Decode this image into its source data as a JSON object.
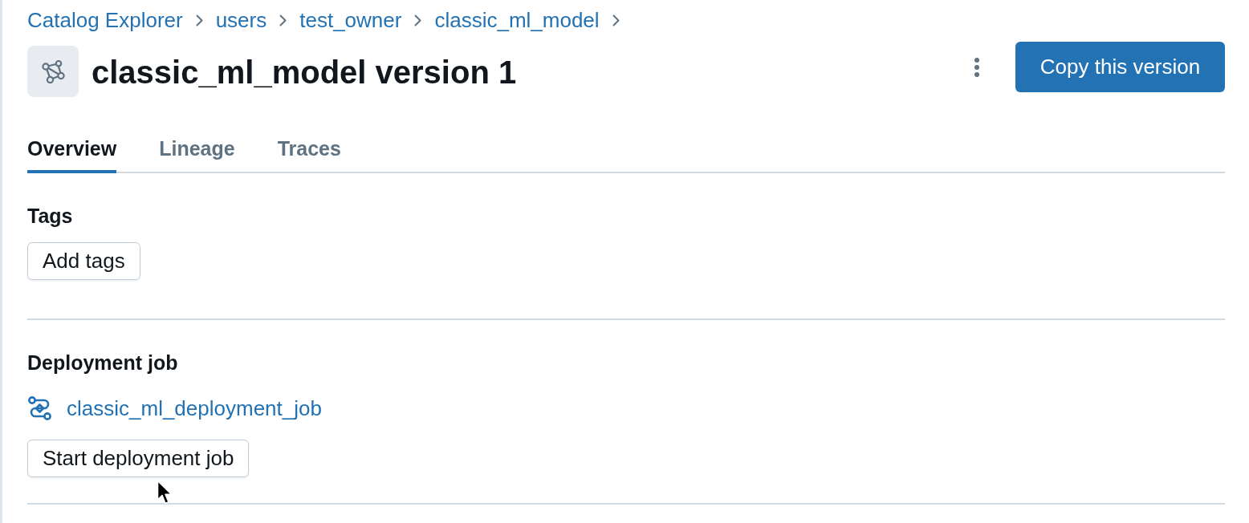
{
  "breadcrumbs": [
    "Catalog Explorer",
    "users",
    "test_owner",
    "classic_ml_model"
  ],
  "header": {
    "title": "classic_ml_model version 1",
    "primary_button": "Copy this version"
  },
  "tabs": [
    {
      "label": "Overview",
      "selected": true
    },
    {
      "label": "Lineage",
      "selected": false
    },
    {
      "label": "Traces",
      "selected": false
    }
  ],
  "sections": [
    {
      "kind": "tags",
      "heading": "Tags",
      "button": "Add tags"
    },
    {
      "kind": "deployment",
      "heading": "Deployment job",
      "link": "classic_ml_deployment_job",
      "button": "Start deployment job"
    }
  ]
}
